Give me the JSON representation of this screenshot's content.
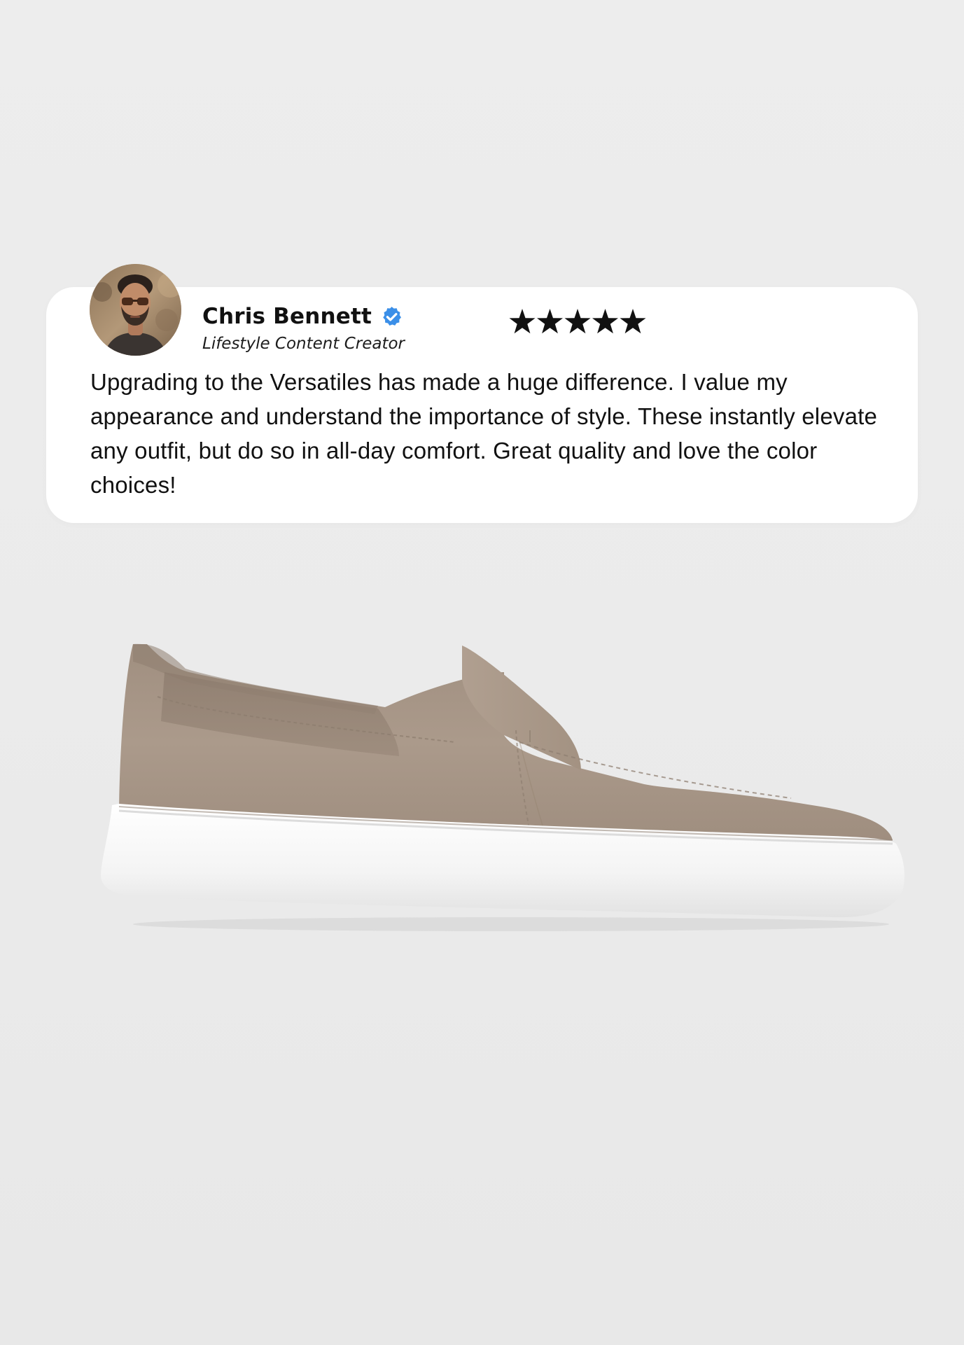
{
  "review": {
    "reviewer_name": "Chris Bennett",
    "reviewer_title": "Lifestyle Content Creator",
    "rating": 5,
    "rating_max": 5,
    "text": "Upgrading to the Versatiles has made a huge difference. I value my appearance and understand the importance of style. These instantly elevate any outfit, but do so in all-day comfort. Great quality and love the color choices!"
  },
  "icons": {
    "verified": "verified-badge-icon",
    "star": "star-icon"
  },
  "colors": {
    "background": "#ebebeb",
    "card": "#ffffff",
    "verified_badge": "#3b8fe8",
    "stars": "#111111",
    "shoe_upper": "#a89788",
    "shoe_sole": "#f6f6f6"
  }
}
